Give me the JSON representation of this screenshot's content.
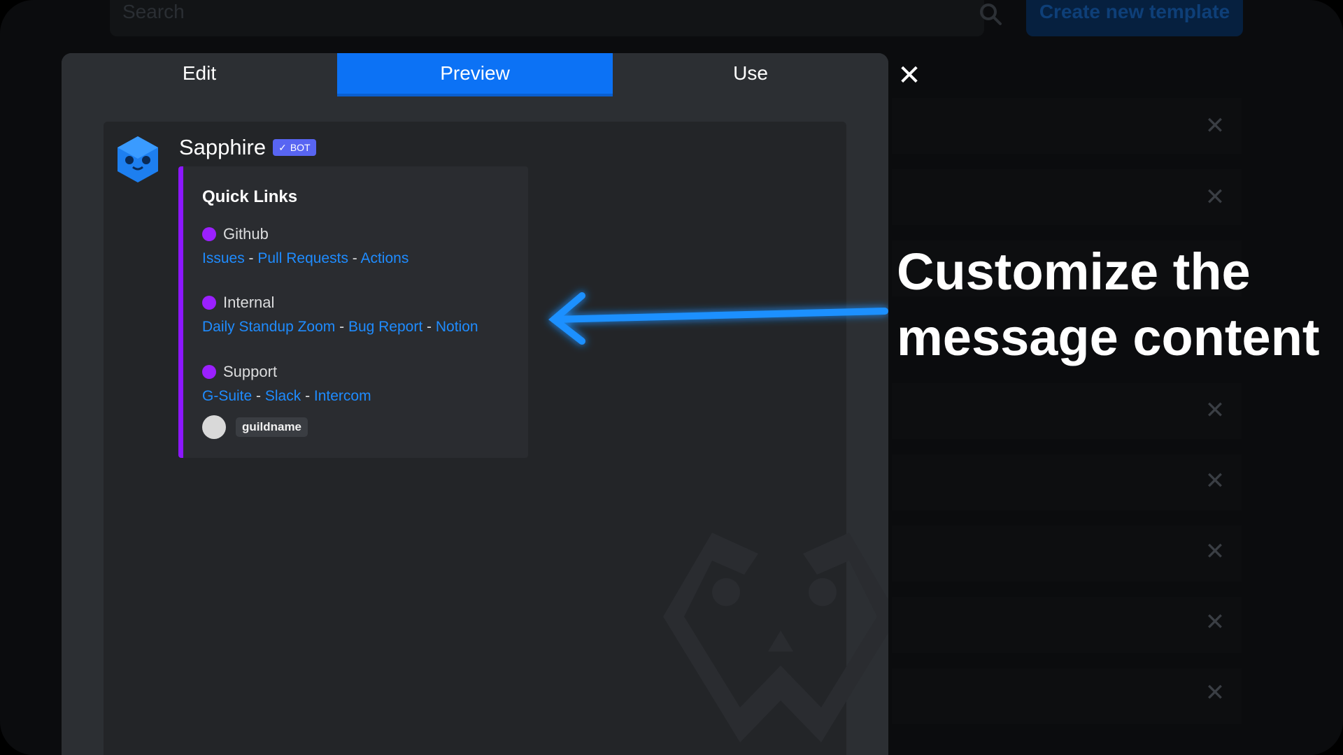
{
  "background": {
    "search_placeholder": "Search",
    "create_button_label": "Create new template",
    "icons": {
      "search": "search-icon",
      "row_close": "close-icon"
    }
  },
  "modal": {
    "tabs": [
      {
        "label": "Edit",
        "active": false
      },
      {
        "label": "Preview",
        "active": true
      },
      {
        "label": "Use",
        "active": false
      }
    ],
    "close_icon": "close-icon"
  },
  "message": {
    "author": "Sapphire",
    "badge": "BOT",
    "embed": {
      "accent_color": "#8c17ff",
      "title": "Quick Links",
      "sections": [
        {
          "name": "Github",
          "links": [
            "Issues",
            "Pull Requests",
            "Actions"
          ]
        },
        {
          "name": "Internal",
          "links": [
            "Daily Standup Zoom",
            "Bug Report",
            "Notion"
          ]
        },
        {
          "name": "Support",
          "links": [
            "G-Suite",
            "Slack",
            "Intercom"
          ]
        }
      ],
      "footer_text": "guildname"
    }
  },
  "callout": {
    "line1": "Customize the",
    "line2": "message content"
  },
  "colors": {
    "accent_blue": "#0c72f5",
    "link_blue": "#1f8cff",
    "bot_badge": "#5865f2",
    "embed_bar": "#8c17ff"
  }
}
